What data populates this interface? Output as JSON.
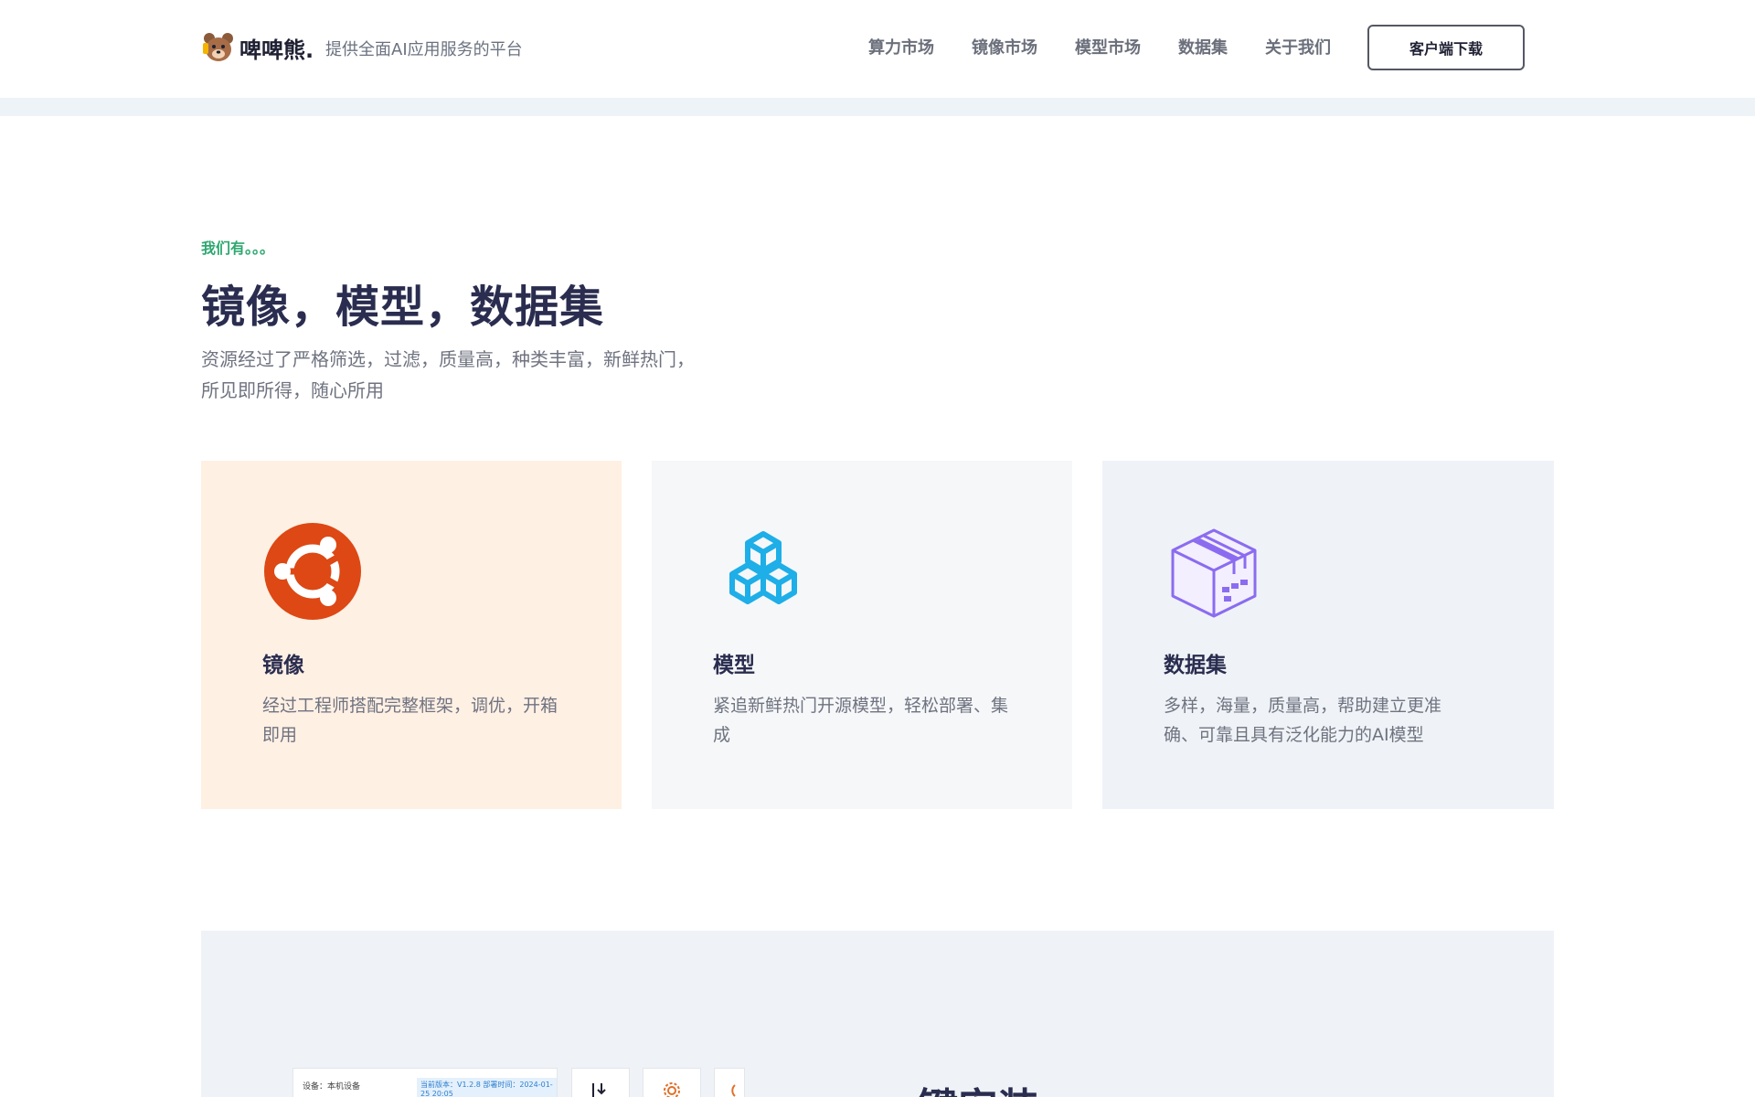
{
  "header": {
    "logo_text": "啤啤熊.",
    "tagline": "提供全面AI应用服务的平台",
    "nav": [
      "算力市场",
      "镜像市场",
      "模型市场",
      "数据集",
      "关于我们"
    ],
    "download_label": "客户端下载"
  },
  "intro": {
    "eyebrow": "我们有。。。",
    "title": "镜像，模型，数据集",
    "desc_line1": "资源经过了严格筛选，过滤，质量高，种类丰富，新鲜热门，",
    "desc_line2": "所见即所得，随心所用"
  },
  "cards": [
    {
      "icon": "ubuntu-icon",
      "title": "镜像",
      "desc": "经过工程师搭配完整框架，调优，开箱即用",
      "bg": "#fff0e4"
    },
    {
      "icon": "cubes-icon",
      "title": "模型",
      "desc": "紧追新鲜热门开源模型，轻松部署、集成",
      "bg": "#f5f7f9"
    },
    {
      "icon": "box-icon",
      "title": "数据集",
      "desc": "多样，海量，质量高，帮助建立更准确、可靠且具有泛化能力的AI模型",
      "bg": "#eff3f7"
    }
  ],
  "lower": {
    "title": "一键安装",
    "mock_device": "设备：本机设备",
    "mock_version": "当前版本：V1.2.8  部署时间：2024-01-25 20:05"
  },
  "colors": {
    "accent_green": "#2ea770",
    "ubuntu_orange": "#dd4814",
    "cubes_blue": "#1eaee8",
    "box_purple": "#8b6cf0",
    "title_navy": "#2a2d4f"
  }
}
